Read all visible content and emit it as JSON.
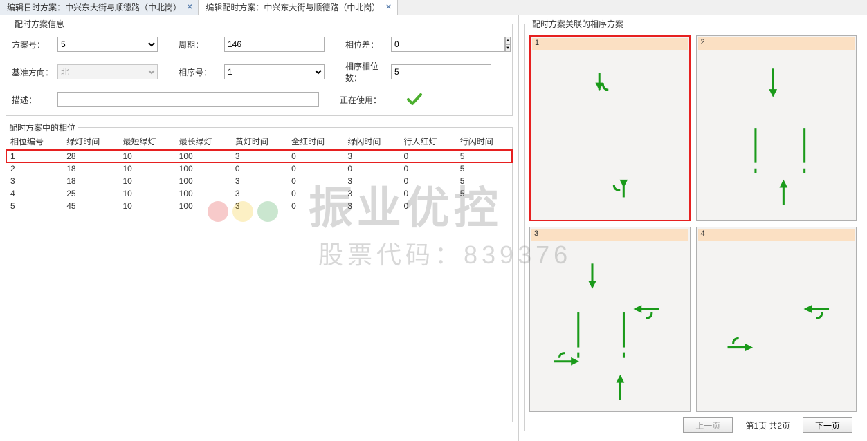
{
  "tabs": [
    {
      "label": "编辑日时方案：中兴东大街与顺德路（中北岗）",
      "active": false
    },
    {
      "label": "编辑配时方案：中兴东大街与顺德路（中北岗）",
      "active": true
    }
  ],
  "info": {
    "legend": "配时方案信息",
    "plan_no_label": "方案号：",
    "plan_no": "5",
    "cycle_label": "周期：",
    "cycle": "146",
    "offset_label": "相位差：",
    "offset": "0",
    "base_dir_label": "基准方向：",
    "base_dir": "北",
    "seq_no_label": "相序号：",
    "seq_no": "1",
    "seq_phase_count_label": "相序相位数：",
    "seq_phase_count": "5",
    "desc_label": "描述：",
    "desc": "",
    "in_use_label": "正在使用："
  },
  "phase_section_legend": "配时方案中的相位",
  "phase_table": {
    "headers": [
      "相位编号",
      "绿灯时间",
      "最短绿灯",
      "最长绿灯",
      "黄灯时间",
      "全红时间",
      "绿闪时间",
      "行人红灯",
      "行闪时间"
    ],
    "rows": [
      {
        "cells": [
          "1",
          "28",
          "10",
          "100",
          "3",
          "0",
          "3",
          "0",
          "5"
        ],
        "highlight": true
      },
      {
        "cells": [
          "2",
          "18",
          "10",
          "100",
          "0",
          "0",
          "0",
          "0",
          "5"
        ],
        "highlight": false
      },
      {
        "cells": [
          "3",
          "18",
          "10",
          "100",
          "3",
          "0",
          "3",
          "0",
          "5"
        ],
        "highlight": false
      },
      {
        "cells": [
          "4",
          "25",
          "10",
          "100",
          "3",
          "0",
          "3",
          "0",
          "5"
        ],
        "highlight": false
      },
      {
        "cells": [
          "5",
          "45",
          "10",
          "100",
          "3",
          "0",
          "3",
          "0",
          ""
        ],
        "highlight": false
      }
    ]
  },
  "linked_legend": "配时方案关联的相序方案",
  "phase_cells": [
    {
      "num": "1",
      "selected": true
    },
    {
      "num": "2",
      "selected": false
    },
    {
      "num": "3",
      "selected": false
    },
    {
      "num": "4",
      "selected": false
    }
  ],
  "pager": {
    "prev": "上一页",
    "status": "第1页  共2页",
    "next": "下一页"
  },
  "watermark": {
    "brand": "振业优控",
    "sub": "股票代码：839376"
  }
}
